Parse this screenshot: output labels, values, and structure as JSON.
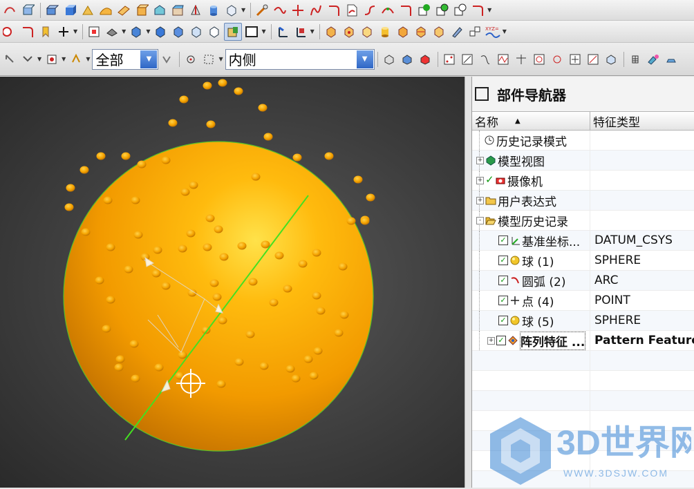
{
  "toolbar3": {
    "filter_combo": "全部",
    "scope_combo": "内侧"
  },
  "navigator": {
    "title": "部件导航器",
    "columns": {
      "name": "名称",
      "sort_arrow": "▲",
      "type": "特征类型"
    },
    "rows": [
      {
        "name": "历史记录模式",
        "type": "",
        "icon": "clock-icon",
        "expander": "",
        "checked": false
      },
      {
        "name": "模型视图",
        "type": "",
        "icon": "model-view-icon",
        "expander": "+",
        "checked": false
      },
      {
        "name": "摄像机",
        "type": "",
        "icon": "camera-icon",
        "expander": "+",
        "checked": true
      },
      {
        "name": "用户表达式",
        "type": "",
        "icon": "folder-icon",
        "expander": "+",
        "checked": false
      },
      {
        "name": "模型历史记录",
        "type": "",
        "icon": "folder-open-icon",
        "expander": "-",
        "checked": false
      },
      {
        "name": "基准坐标...",
        "type": "DATUM_CSYS",
        "icon": "datum-csys-icon",
        "expander": "",
        "checked": true
      },
      {
        "name": "球 (1)",
        "type": "SPHERE",
        "icon": "sphere-icon",
        "expander": "",
        "checked": true
      },
      {
        "name": "圆弧 (2)",
        "type": "ARC",
        "icon": "arc-icon",
        "expander": "",
        "checked": true
      },
      {
        "name": "点 (4)",
        "type": "POINT",
        "icon": "point-icon",
        "expander": "",
        "checked": true
      },
      {
        "name": "球 (5)",
        "type": "SPHERE",
        "icon": "sphere-icon",
        "expander": "",
        "checked": true
      },
      {
        "name": "阵列特征 ...",
        "type": "Pattern Feature",
        "icon": "pattern-feature-icon",
        "expander": "+",
        "checked": true
      }
    ]
  },
  "watermark": {
    "text": "3D世界网",
    "url": "WWW.3DSJW.COM"
  },
  "colors": {
    "sphere": "#f5a300",
    "axis": "#33dd22",
    "accent": "#2f67c6"
  }
}
